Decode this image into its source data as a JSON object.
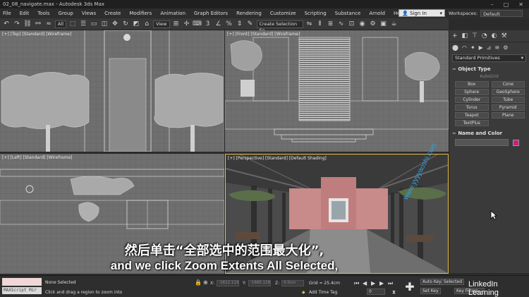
{
  "window": {
    "title": "02_08_navigate.max - Autodesk 3ds Max"
  },
  "menu": [
    "File",
    "Edit",
    "Tools",
    "Group",
    "Views",
    "Create",
    "Modifiers",
    "Animation",
    "Graph Editors",
    "Rendering",
    "Customize",
    "Scripting",
    "Substance",
    "Arnold",
    "Help"
  ],
  "account": {
    "sign_in": "Sign In",
    "workspaces_label": "Workspaces:",
    "workspace": "Default"
  },
  "toolbar": {
    "filter": "All",
    "view": "View",
    "create_selection": "Create Selection Se"
  },
  "viewports": {
    "top": "[+] [Top] [Standard] [Wireframe]",
    "front": "[+] [Front] [Standard] [Wireframe]",
    "left": "[+] [Left] [Standard] [Wireframe]",
    "perspective": "[+] [Perspective] [Standard] [Default Shading]"
  },
  "command_panel": {
    "category": "Standard Primitives",
    "object_type": "Object Type",
    "autogrid": "AutoGrid",
    "primitives": [
      "Box",
      "Cone",
      "Sphere",
      "GeoSphere",
      "Cylinder",
      "Tube",
      "Torus",
      "Pyramid",
      "Teapot",
      "Plane",
      "TextPlus"
    ],
    "name_and_color": "Name and Color",
    "object_color": "#c8207a"
  },
  "status": {
    "maxscript": "MAXScript Mir",
    "selection": "None Selected",
    "prompt": "Click and drag a region to zoom into",
    "x_label": "X:",
    "x_value": "-1612.119",
    "y_label": "Y:",
    "y_value": "-1685.128",
    "z_label": "Z:",
    "z_value": "0.0cm",
    "grid": "Grid = 25.4cm",
    "add_time_tag": "Add Time Tag",
    "frame": "0",
    "auto_key": "Auto Key",
    "selected": "Selected",
    "set_key": "Set Key",
    "key_filters": "Key Filters..."
  },
  "subtitles": {
    "chinese": "然后单击“全部选中的范围最大化”,",
    "english": "and we click Zoom Extents All Selected,"
  },
  "watermark": "www.yyyyaoshi.com",
  "brand": "LinkedIn Learning"
}
